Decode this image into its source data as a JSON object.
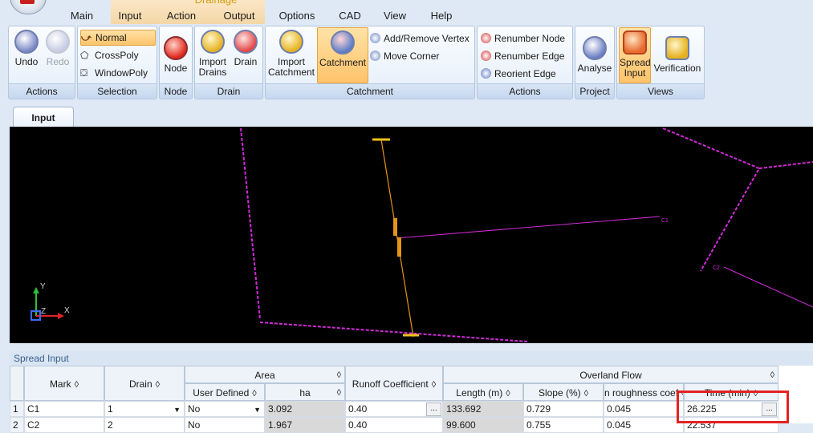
{
  "window": {
    "context_tab_label": "Drainage",
    "tabs": [
      "Main",
      "Input",
      "Action",
      "Output",
      "Options",
      "CAD",
      "View",
      "Help"
    ]
  },
  "ribbon": {
    "groups": {
      "actions": "Actions",
      "selection": "Selection",
      "node": "Node",
      "drain": "Drain",
      "catchment": "Catchment",
      "actions2": "Actions",
      "project": "Project",
      "views": "Views"
    },
    "buttons": {
      "undo": "Undo",
      "redo": "Redo",
      "normal": "Normal",
      "crosspoly": "CrossPoly",
      "windowpoly": "WindowPoly",
      "node": "Node",
      "import_drains": "Import Drains",
      "drain": "Drain",
      "import_catchment": "Import Catchment",
      "catchment": "Catchment",
      "add_remove_vertex": "Add/Remove Vertex",
      "move_corner": "Move Corner",
      "renumber_node": "Renumber Node",
      "renumber_edge": "Renumber Edge",
      "reorient_edge": "Reorient Edge",
      "analyse": "Analyse",
      "spread_input": "Spread Input",
      "verification": "Verification"
    }
  },
  "view_tab": {
    "label": "Input"
  },
  "canvas": {
    "labels": {
      "c1": "C1",
      "c2": "C2"
    },
    "axis": {
      "y": "Y",
      "z": "Z",
      "x": "X"
    }
  },
  "panel": {
    "title": "Spread Input"
  },
  "table": {
    "headers": {
      "mark": "Mark",
      "drain": "Drain",
      "area": "Area",
      "user_defined": "User Defined",
      "ha": "ha",
      "runoff_coefficient": "Runoff Coefficient",
      "overland_flow": "Overland Flow",
      "length": "Length (m)",
      "slope": "Slope (%)",
      "n_roughness": "n roughness coef",
      "time": "Time (min)"
    },
    "sort_glyph": "◊",
    "rows": [
      {
        "index": "1",
        "mark": "C1",
        "drain": "1",
        "user_defined": "No",
        "ha": "3.092",
        "runoff": "0.40",
        "length": "133.692",
        "slope": "0.729",
        "n": "0.045",
        "time": "26.225"
      },
      {
        "index": "2",
        "mark": "C2",
        "drain": "2",
        "user_defined": "No",
        "ha": "1.967",
        "runoff": "0.40",
        "length": "99.600",
        "slope": "0.755",
        "n": "0.045",
        "time": "22.537"
      }
    ]
  }
}
